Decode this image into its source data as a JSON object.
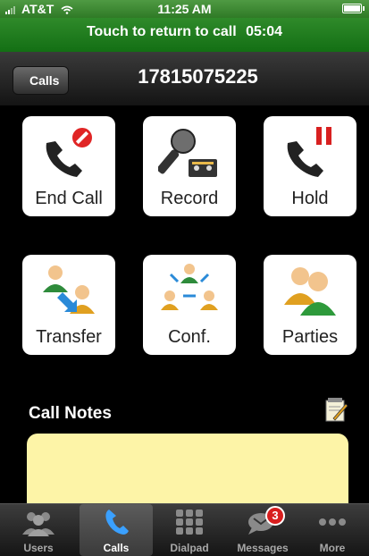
{
  "status": {
    "carrier": "AT&T",
    "time": "11:25 AM"
  },
  "call_banner": {
    "text": "Touch to return to call",
    "timer": "05:04"
  },
  "nav": {
    "back_label": "Calls",
    "title": "17815075225"
  },
  "actions": [
    {
      "label": "End Call",
      "icon": "end-call-icon"
    },
    {
      "label": "Record",
      "icon": "record-icon"
    },
    {
      "label": "Hold",
      "icon": "hold-icon"
    },
    {
      "label": "Transfer",
      "icon": "transfer-icon"
    },
    {
      "label": "Conf.",
      "icon": "conference-icon"
    },
    {
      "label": "Parties",
      "icon": "parties-icon"
    }
  ],
  "notes": {
    "title": "Call Notes",
    "value": ""
  },
  "tabs": [
    {
      "label": "Users",
      "icon": "users-icon",
      "active": false
    },
    {
      "label": "Calls",
      "icon": "phone-icon",
      "active": true
    },
    {
      "label": "Dialpad",
      "icon": "dialpad-icon",
      "active": false
    },
    {
      "label": "Messages",
      "icon": "messages-icon",
      "active": false,
      "badge": "3"
    },
    {
      "label": "More",
      "icon": "more-icon",
      "active": false
    }
  ],
  "colors": {
    "status_green": "#2f7a26",
    "notes_yellow": "#fdf4a7",
    "badge_red": "#d81e1e"
  }
}
